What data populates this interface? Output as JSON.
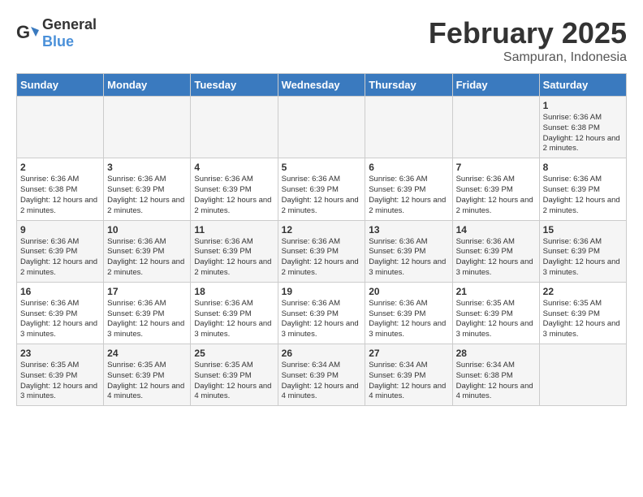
{
  "logo": {
    "general": "General",
    "blue": "Blue"
  },
  "header": {
    "month": "February 2025",
    "location": "Sampuran, Indonesia"
  },
  "days_of_week": [
    "Sunday",
    "Monday",
    "Tuesday",
    "Wednesday",
    "Thursday",
    "Friday",
    "Saturday"
  ],
  "weeks": [
    [
      {
        "day": "",
        "info": ""
      },
      {
        "day": "",
        "info": ""
      },
      {
        "day": "",
        "info": ""
      },
      {
        "day": "",
        "info": ""
      },
      {
        "day": "",
        "info": ""
      },
      {
        "day": "",
        "info": ""
      },
      {
        "day": "1",
        "info": "Sunrise: 6:36 AM\nSunset: 6:38 PM\nDaylight: 12 hours and 2 minutes."
      }
    ],
    [
      {
        "day": "2",
        "info": "Sunrise: 6:36 AM\nSunset: 6:38 PM\nDaylight: 12 hours and 2 minutes."
      },
      {
        "day": "3",
        "info": "Sunrise: 6:36 AM\nSunset: 6:39 PM\nDaylight: 12 hours and 2 minutes."
      },
      {
        "day": "4",
        "info": "Sunrise: 6:36 AM\nSunset: 6:39 PM\nDaylight: 12 hours and 2 minutes."
      },
      {
        "day": "5",
        "info": "Sunrise: 6:36 AM\nSunset: 6:39 PM\nDaylight: 12 hours and 2 minutes."
      },
      {
        "day": "6",
        "info": "Sunrise: 6:36 AM\nSunset: 6:39 PM\nDaylight: 12 hours and 2 minutes."
      },
      {
        "day": "7",
        "info": "Sunrise: 6:36 AM\nSunset: 6:39 PM\nDaylight: 12 hours and 2 minutes."
      },
      {
        "day": "8",
        "info": "Sunrise: 6:36 AM\nSunset: 6:39 PM\nDaylight: 12 hours and 2 minutes."
      }
    ],
    [
      {
        "day": "9",
        "info": "Sunrise: 6:36 AM\nSunset: 6:39 PM\nDaylight: 12 hours and 2 minutes."
      },
      {
        "day": "10",
        "info": "Sunrise: 6:36 AM\nSunset: 6:39 PM\nDaylight: 12 hours and 2 minutes."
      },
      {
        "day": "11",
        "info": "Sunrise: 6:36 AM\nSunset: 6:39 PM\nDaylight: 12 hours and 2 minutes."
      },
      {
        "day": "12",
        "info": "Sunrise: 6:36 AM\nSunset: 6:39 PM\nDaylight: 12 hours and 2 minutes."
      },
      {
        "day": "13",
        "info": "Sunrise: 6:36 AM\nSunset: 6:39 PM\nDaylight: 12 hours and 3 minutes."
      },
      {
        "day": "14",
        "info": "Sunrise: 6:36 AM\nSunset: 6:39 PM\nDaylight: 12 hours and 3 minutes."
      },
      {
        "day": "15",
        "info": "Sunrise: 6:36 AM\nSunset: 6:39 PM\nDaylight: 12 hours and 3 minutes."
      }
    ],
    [
      {
        "day": "16",
        "info": "Sunrise: 6:36 AM\nSunset: 6:39 PM\nDaylight: 12 hours and 3 minutes."
      },
      {
        "day": "17",
        "info": "Sunrise: 6:36 AM\nSunset: 6:39 PM\nDaylight: 12 hours and 3 minutes."
      },
      {
        "day": "18",
        "info": "Sunrise: 6:36 AM\nSunset: 6:39 PM\nDaylight: 12 hours and 3 minutes."
      },
      {
        "day": "19",
        "info": "Sunrise: 6:36 AM\nSunset: 6:39 PM\nDaylight: 12 hours and 3 minutes."
      },
      {
        "day": "20",
        "info": "Sunrise: 6:36 AM\nSunset: 6:39 PM\nDaylight: 12 hours and 3 minutes."
      },
      {
        "day": "21",
        "info": "Sunrise: 6:35 AM\nSunset: 6:39 PM\nDaylight: 12 hours and 3 minutes."
      },
      {
        "day": "22",
        "info": "Sunrise: 6:35 AM\nSunset: 6:39 PM\nDaylight: 12 hours and 3 minutes."
      }
    ],
    [
      {
        "day": "23",
        "info": "Sunrise: 6:35 AM\nSunset: 6:39 PM\nDaylight: 12 hours and 3 minutes."
      },
      {
        "day": "24",
        "info": "Sunrise: 6:35 AM\nSunset: 6:39 PM\nDaylight: 12 hours and 4 minutes."
      },
      {
        "day": "25",
        "info": "Sunrise: 6:35 AM\nSunset: 6:39 PM\nDaylight: 12 hours and 4 minutes."
      },
      {
        "day": "26",
        "info": "Sunrise: 6:34 AM\nSunset: 6:39 PM\nDaylight: 12 hours and 4 minutes."
      },
      {
        "day": "27",
        "info": "Sunrise: 6:34 AM\nSunset: 6:39 PM\nDaylight: 12 hours and 4 minutes."
      },
      {
        "day": "28",
        "info": "Sunrise: 6:34 AM\nSunset: 6:38 PM\nDaylight: 12 hours and 4 minutes."
      },
      {
        "day": "",
        "info": ""
      }
    ]
  ]
}
